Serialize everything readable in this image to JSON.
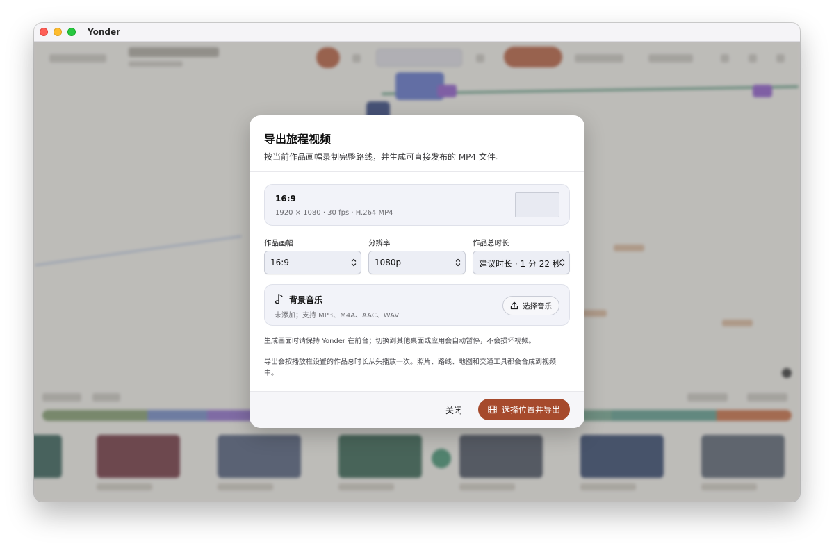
{
  "window": {
    "title": "Yonder"
  },
  "dialog": {
    "title": "导出旅程视频",
    "description": "按当前作品画幅录制完整路线，并生成可直接发布的 MP4 文件。",
    "preset": {
      "name": "16:9",
      "spec": "1920 × 1080 · 30 fps · H.264 MP4"
    },
    "fields": {
      "aspect": {
        "label": "作品画幅",
        "value": "16:9"
      },
      "resolution": {
        "label": "分辨率",
        "value": "1080p"
      },
      "duration": {
        "label": "作品总时长",
        "value": "建议时长 · 1 分 22 秒"
      }
    },
    "music": {
      "title": "背景音乐",
      "subtitle": "未添加；支持 MP3、M4A、AAC、WAV",
      "button_label": "选择音乐",
      "icon": "music-note-icon"
    },
    "notes": [
      "生成画面时请保持 Yonder 在前台；切换到其他桌面或应用会自动暂停，不会损坏视频。",
      "导出会按播放栏设置的作品总时长从头播放一次。照片、路线、地图和交通工具都会合成到视频中。"
    ],
    "footer": {
      "close_label": "关闭",
      "export_label": "选择位置并导出",
      "export_icon": "film-icon"
    }
  },
  "colors": {
    "accent": "#a64a2c",
    "card_bg": "#f2f3f9"
  }
}
